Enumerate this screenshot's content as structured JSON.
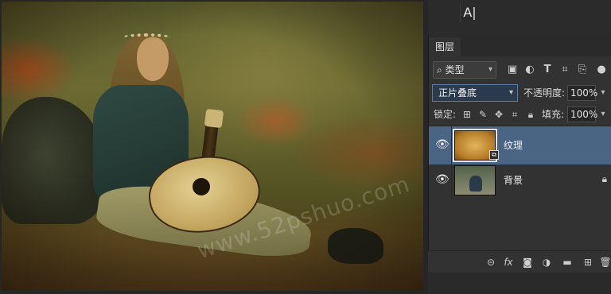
{
  "canvas": {
    "watermark": "www.52pshuo.com"
  },
  "toolbar": {
    "type_tool_label": "A|"
  },
  "layers_panel": {
    "tab_label": "图层",
    "filter": {
      "kind_label": "类型",
      "icons": [
        "image-filter-icon",
        "adjustment-filter-icon",
        "text-filter-icon",
        "shape-filter-icon",
        "smart-object-filter-icon",
        "filter-toggle-icon"
      ]
    },
    "blend_mode": "正片叠底",
    "opacity_label": "不透明度:",
    "opacity_value": "100%",
    "lock_label": "锁定:",
    "fill_label": "填充:",
    "fill_value": "100%",
    "layers": [
      {
        "name": "纹理",
        "selected": true,
        "visible": true,
        "thumb": "texture",
        "locked": false
      },
      {
        "name": "背景",
        "selected": false,
        "visible": true,
        "thumb": "photo",
        "locked": true
      }
    ],
    "footer_icons": [
      "link-layers-icon",
      "fx-icon",
      "add-mask-icon",
      "adjustment-layer-icon",
      "new-group-icon",
      "new-layer-icon",
      "delete-layer-icon"
    ],
    "fx_label": "fx"
  },
  "colors": {
    "panel_bg": "#323232",
    "selected_layer": "#4a6584",
    "blend_border": "#5b7ca8"
  }
}
